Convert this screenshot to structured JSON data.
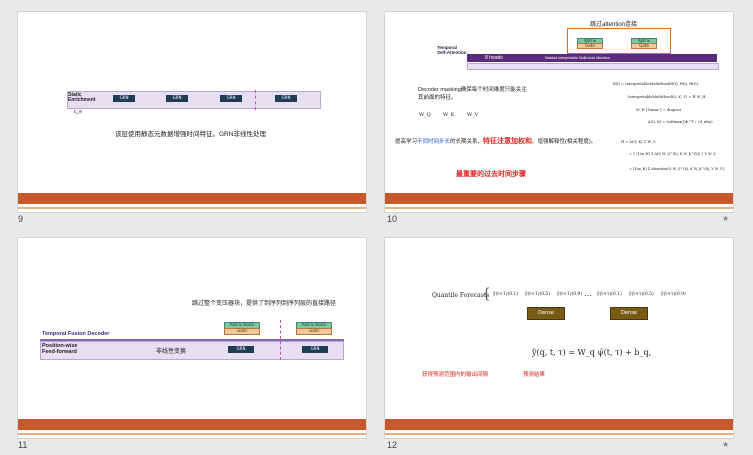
{
  "slides": [
    {
      "number": "9",
      "diagram_label": "Static\nEnrichment",
      "diagram_sub": "c_e",
      "grn_blocks": [
        "GRN",
        "GRN",
        "GRN",
        "GRN"
      ],
      "caption": "该层使用静态元数据增强时间特征。GRN非线性处理"
    },
    {
      "number": "10",
      "top_note": "跳过attention连接",
      "diagram_label": "Temporal\nSelf-Attention",
      "heads_label": "8 heads",
      "attention_label": "Masked Interpretable Multi-head Attention",
      "add_norm": "Add & Norm",
      "gate": "Gate",
      "masking_text": "Decoder masking确保每个时间维度只能关注其前面的特征。",
      "weights": [
        "W_Q",
        "W_K",
        "W_V"
      ],
      "longrange_text_a": "提高学习",
      "longrange_text_b": "不同时间步长",
      "longrange_text_c": "的长期关系，",
      "longrange_red": "特征注意加权和",
      "longrange_text_d": "。增强解释性(相关程度)。",
      "red_note": "最重要的过去时间步骤",
      "formula1": "B(t) = InterpretableMultiHead(Θ(t), Θ(t), Θ(t)),",
      "formula2": "InterpretableMultiHead(Q, K, V) = H̃ W_H,",
      "formula3": "W_H [ linear ] → dropout",
      "formula4": "A(Q, K) = Softmax(QK^T / √d_attn)",
      "formula5": "H̃ = Ã(Q, K) V W_V,",
      "formula6": "= { (1/m_H) Σ A(Q W_Q^(h), K W_K^(h)) } V W_V,",
      "formula7": "= (1/m_H) Σ Attention(Q W_Q^(h), K W_K^(h), V W_V),"
    },
    {
      "number": "11",
      "top_note": "跳过整个变压器块，提供了到序列到序列层的直接路径",
      "diagram_title": "Temporal Fusion Decoder",
      "diagram_label": "Position-wise\nFeed-forward",
      "nonlinear": "非线性变换",
      "add_norm": "Add & Norm",
      "gate": "Gate",
      "grn": "GRN"
    },
    {
      "number": "12",
      "quantile_label": "Quantile Forecasts",
      "quantiles": [
        "ŷ(t+1)(0.1)",
        "ŷ(t+1)(0.5)",
        "ŷ(t+1)(0.9)",
        "…",
        "ŷ(t+τ)(0.1)",
        "ŷ(t+τ)(0.5)",
        "ŷ(t+τ)(0.9)"
      ],
      "dense": "Dense",
      "formula": "ŷ(q, t, τ) = W_q ψ̃(t, τ) + b_q,",
      "red_left": "获得预测范围内的输出间隔",
      "red_right": "预测结果"
    }
  ],
  "star_icon": "★"
}
